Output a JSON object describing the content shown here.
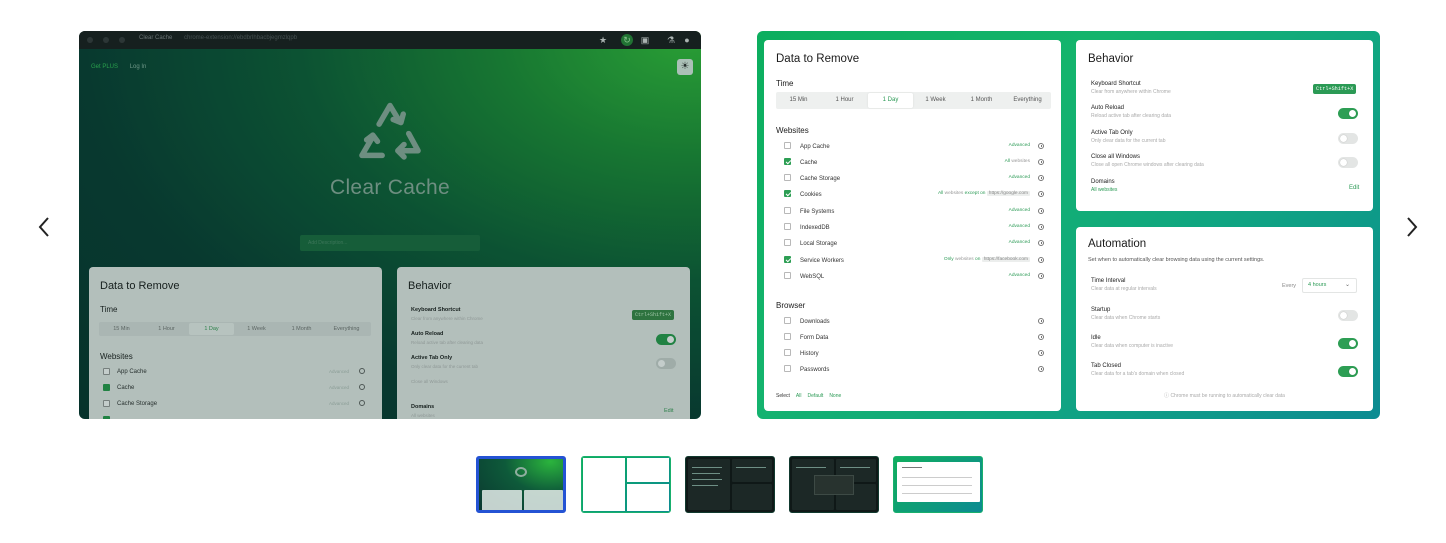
{
  "left_slide": {
    "browser": {
      "tab_title": "Clear Cache",
      "url": "chrome-extension://ebdbrlhbacbjegmzlqpb"
    },
    "links": {
      "plus": "Get PLUS",
      "login": "Log In"
    },
    "app_title": "Clear Cache",
    "search_placeholder": "Add Description...",
    "data_card": {
      "title": "Data to Remove",
      "time_label": "Time",
      "time_options": [
        "15 Min",
        "1 Hour",
        "1 Day",
        "1 Week",
        "1 Month",
        "Everything"
      ],
      "selected_time": "1 Day",
      "websites_label": "Websites",
      "items": [
        {
          "label": "App Cache",
          "checked": false
        },
        {
          "label": "Cache",
          "checked": true
        },
        {
          "label": "Cache Storage",
          "checked": false
        }
      ],
      "advanced_label": "Advanced"
    },
    "behavior_card": {
      "title": "Behavior",
      "rows": [
        {
          "title": "Keyboard Shortcut",
          "desc": "Clear from anywhere within Chrome"
        },
        {
          "title": "Auto Reload",
          "desc": "Reload active tab after clearing data"
        },
        {
          "title": "Active Tab Only",
          "desc": "Only clear data for the current tab"
        },
        {
          "title": "Close all Windows",
          "desc": ""
        },
        {
          "title": "Domains",
          "desc": "All websites"
        }
      ],
      "shortcut": "Ctrl+Shift+X",
      "edit_label": "Edit"
    }
  },
  "right_slide": {
    "data_card": {
      "title": "Data to Remove",
      "time_label": "Time",
      "time_options": [
        "15 Min",
        "1 Hour",
        "1 Day",
        "1 Week",
        "1 Month",
        "Everything"
      ],
      "selected_time": "1 Day",
      "websites_label": "Websites",
      "websites": [
        {
          "label": "App Cache",
          "checked": false,
          "mode": "Advanced"
        },
        {
          "label": "Cache",
          "checked": true,
          "mode": "All websites"
        },
        {
          "label": "Cache Storage",
          "checked": false,
          "mode": "Advanced"
        },
        {
          "label": "Cookies",
          "checked": true,
          "mode": "All websites except on https://google.com"
        },
        {
          "label": "File Systems",
          "checked": false,
          "mode": "Advanced"
        },
        {
          "label": "IndexedDB",
          "checked": false,
          "mode": "Advanced"
        },
        {
          "label": "Local Storage",
          "checked": false,
          "mode": "Advanced"
        },
        {
          "label": "Service Workers",
          "checked": true,
          "mode": "Only websites on https://facebook.com"
        },
        {
          "label": "WebSQL",
          "checked": false,
          "mode": "Advanced"
        }
      ],
      "browser_label": "Browser",
      "browser_items": [
        {
          "label": "Downloads",
          "checked": false
        },
        {
          "label": "Form Data",
          "checked": false
        },
        {
          "label": "History",
          "checked": false
        },
        {
          "label": "Passwords",
          "checked": false
        }
      ],
      "select": {
        "label": "Select",
        "all": "All",
        "default": "Default",
        "none": "None"
      }
    },
    "behavior_card": {
      "title": "Behavior",
      "shortcut": "Ctrl+Shift+X",
      "rows": [
        {
          "title": "Keyboard Shortcut",
          "desc": "Clear from anywhere within Chrome"
        },
        {
          "title": "Auto Reload",
          "desc": "Reload active tab after clearing data",
          "on": true
        },
        {
          "title": "Active Tab Only",
          "desc": "Only clear data for the current tab",
          "on": false
        },
        {
          "title": "Close all Windows",
          "desc": "Close all open Chrome windows after clearing data",
          "on": false
        },
        {
          "title": "Domains",
          "desc": "All websites"
        }
      ],
      "edit_label": "Edit"
    },
    "automation_card": {
      "title": "Automation",
      "desc": "Set when to automatically clear browsing data using the current settings.",
      "rows": [
        {
          "title": "Time Interval",
          "desc": "Clear data at regular intervals"
        },
        {
          "title": "Startup",
          "desc": "Clear data when Chrome starts",
          "on": false
        },
        {
          "title": "Idle",
          "desc": "Clear data when computer is inactive",
          "on": true
        },
        {
          "title": "Tab Closed",
          "desc": "Clear data for a tab's domain when closed",
          "on": true
        }
      ],
      "every_label": "Every",
      "interval_value": "4 hours",
      "note": "Chrome must be running to automatically clear data"
    }
  },
  "colors": {
    "accent": "#2b9a55",
    "selected_thumb_border": "#2453d4"
  },
  "thumbnails": {
    "count": 5,
    "selected_index": 0
  }
}
